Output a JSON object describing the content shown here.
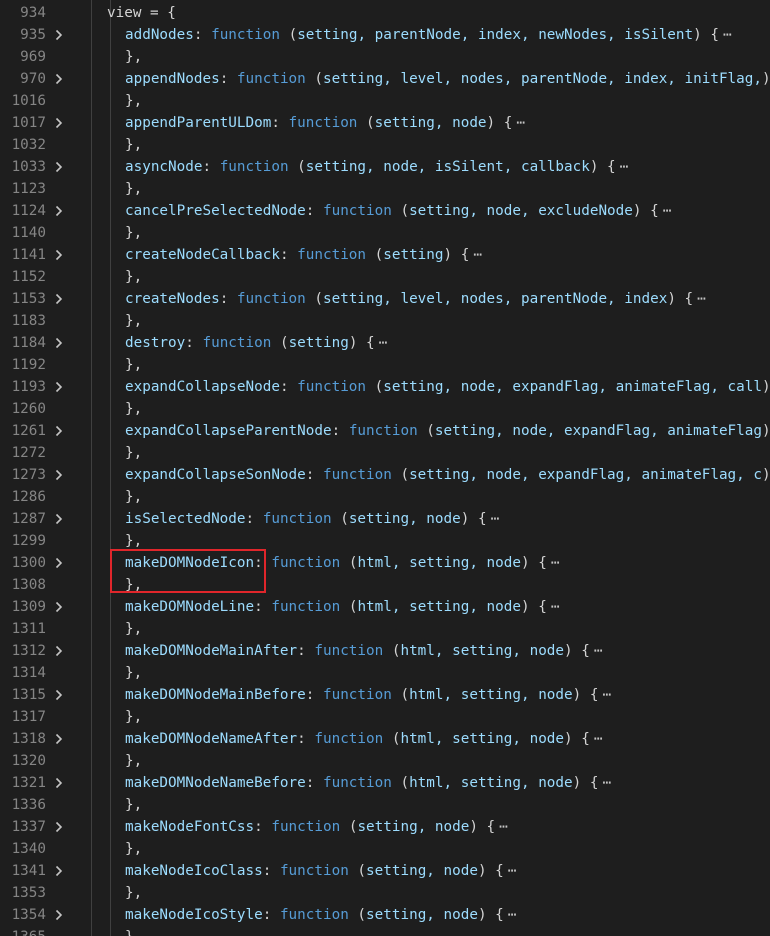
{
  "editor": {
    "colors": {
      "background": "#1e1e1e",
      "line_number": "#858585",
      "keyword": "#569cd6",
      "property": "#9cdcfe",
      "punctuation": "#d4d4d4",
      "highlight_box": "#e0262b"
    },
    "icons": {
      "fold": "chevron-right-icon",
      "ellipsis": "ellipsis-icon"
    },
    "highlighted_line": "1300",
    "lines": [
      {
        "num": "934",
        "kind": "open",
        "text": "view = {"
      },
      {
        "num": "935",
        "kind": "fn",
        "name": "addNodes",
        "params": "setting, parentNode, index, newNodes, isSilent"
      },
      {
        "num": "969",
        "kind": "close",
        "text": "},"
      },
      {
        "num": "970",
        "kind": "fn",
        "name": "appendNodes",
        "params": "setting, level, nodes, parentNode, index, initFlag,"
      },
      {
        "num": "1016",
        "kind": "close",
        "text": "},"
      },
      {
        "num": "1017",
        "kind": "fn",
        "name": "appendParentULDom",
        "params": "setting, node"
      },
      {
        "num": "1032",
        "kind": "close",
        "text": "},"
      },
      {
        "num": "1033",
        "kind": "fn",
        "name": "asyncNode",
        "params": "setting, node, isSilent, callback"
      },
      {
        "num": "1123",
        "kind": "close",
        "text": "},"
      },
      {
        "num": "1124",
        "kind": "fn",
        "name": "cancelPreSelectedNode",
        "params": "setting, node, excludeNode"
      },
      {
        "num": "1140",
        "kind": "close",
        "text": "},"
      },
      {
        "num": "1141",
        "kind": "fn",
        "name": "createNodeCallback",
        "params": "setting"
      },
      {
        "num": "1152",
        "kind": "close",
        "text": "},"
      },
      {
        "num": "1153",
        "kind": "fn",
        "name": "createNodes",
        "params": "setting, level, nodes, parentNode, index"
      },
      {
        "num": "1183",
        "kind": "close",
        "text": "},"
      },
      {
        "num": "1184",
        "kind": "fn",
        "name": "destroy",
        "params": "setting"
      },
      {
        "num": "1192",
        "kind": "close",
        "text": "},"
      },
      {
        "num": "1193",
        "kind": "fn",
        "name": "expandCollapseNode",
        "params": "setting, node, expandFlag, animateFlag, call"
      },
      {
        "num": "1260",
        "kind": "close",
        "text": "},"
      },
      {
        "num": "1261",
        "kind": "fn",
        "name": "expandCollapseParentNode",
        "params": "setting, node, expandFlag, animateFlag"
      },
      {
        "num": "1272",
        "kind": "close",
        "text": "},"
      },
      {
        "num": "1273",
        "kind": "fn",
        "name": "expandCollapseSonNode",
        "params": "setting, node, expandFlag, animateFlag, c"
      },
      {
        "num": "1286",
        "kind": "close",
        "text": "},"
      },
      {
        "num": "1287",
        "kind": "fn",
        "name": "isSelectedNode",
        "params": "setting, node"
      },
      {
        "num": "1299",
        "kind": "close",
        "text": "},"
      },
      {
        "num": "1300",
        "kind": "fn",
        "name": "makeDOMNodeIcon",
        "params": "html, setting, node"
      },
      {
        "num": "1308",
        "kind": "close",
        "text": "},"
      },
      {
        "num": "1309",
        "kind": "fn",
        "name": "makeDOMNodeLine",
        "params": "html, setting, node"
      },
      {
        "num": "1311",
        "kind": "close",
        "text": "},"
      },
      {
        "num": "1312",
        "kind": "fn",
        "name": "makeDOMNodeMainAfter",
        "params": "html, setting, node"
      },
      {
        "num": "1314",
        "kind": "close",
        "text": "},"
      },
      {
        "num": "1315",
        "kind": "fn",
        "name": "makeDOMNodeMainBefore",
        "params": "html, setting, node"
      },
      {
        "num": "1317",
        "kind": "close",
        "text": "},"
      },
      {
        "num": "1318",
        "kind": "fn",
        "name": "makeDOMNodeNameAfter",
        "params": "html, setting, node"
      },
      {
        "num": "1320",
        "kind": "close",
        "text": "},"
      },
      {
        "num": "1321",
        "kind": "fn",
        "name": "makeDOMNodeNameBefore",
        "params": "html, setting, node"
      },
      {
        "num": "1336",
        "kind": "close",
        "text": "},"
      },
      {
        "num": "1337",
        "kind": "fn",
        "name": "makeNodeFontCss",
        "params": "setting, node"
      },
      {
        "num": "1340",
        "kind": "close",
        "text": "},"
      },
      {
        "num": "1341",
        "kind": "fn",
        "name": "makeNodeIcoClass",
        "params": "setting, node"
      },
      {
        "num": "1353",
        "kind": "close",
        "text": "},"
      },
      {
        "num": "1354",
        "kind": "fn",
        "name": "makeNodeIcoStyle",
        "params": "setting, node"
      },
      {
        "num": "1365",
        "kind": "close",
        "text": "},"
      }
    ]
  }
}
